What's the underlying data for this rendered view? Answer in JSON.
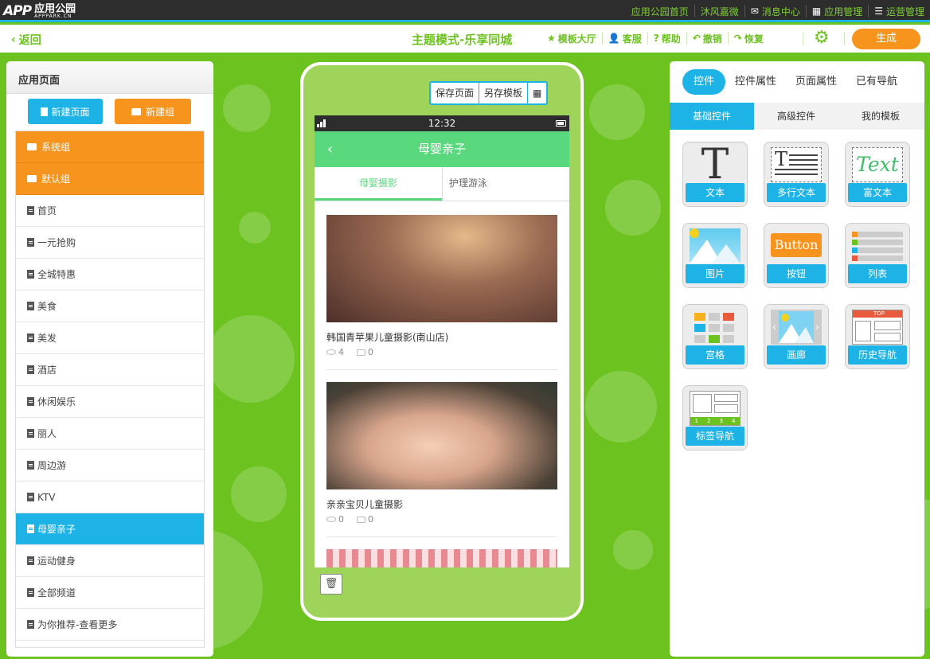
{
  "brand": {
    "mark": "APP",
    "name": "应用公园",
    "sub": "APPPARK.CN"
  },
  "toplinks": [
    {
      "label": "应用公园首页",
      "icon": ""
    },
    {
      "label": "沐风嘉微",
      "icon": ""
    },
    {
      "label": "消息中心",
      "icon": "✉"
    },
    {
      "label": "应用管理",
      "icon": "▦"
    },
    {
      "label": "运营管理",
      "icon": "☰"
    }
  ],
  "subbar": {
    "back": "返回",
    "mode_title": "主题模式-乐享同城",
    "tools": [
      {
        "label": "模板大厅",
        "icon": "★"
      },
      {
        "label": "客服",
        "icon": "👤"
      },
      {
        "label": "帮助",
        "icon": "?"
      },
      {
        "label": "撤销",
        "icon": "↶"
      },
      {
        "label": "恢复",
        "icon": "↷"
      }
    ],
    "generate": "生成"
  },
  "left": {
    "title": "应用页面",
    "new_page": "新建页面",
    "new_group": "新建组",
    "groups": [
      {
        "label": "系统组"
      },
      {
        "label": "默认组"
      }
    ],
    "pages": [
      "首页",
      "一元抢购",
      "全城特惠",
      "美食",
      "美发",
      "酒店",
      "休闲娱乐",
      "丽人",
      "周边游",
      "KTV",
      "母婴亲子",
      "运动健身",
      "全部频道",
      "为你推荐-查看更多"
    ],
    "active_index": 10
  },
  "phone": {
    "tools": [
      "保存页面",
      "另存模板",
      "▦"
    ],
    "time": "12:32",
    "nav_title": "母婴亲子",
    "tabs": [
      "母婴摄影",
      "护理游泳"
    ],
    "items": [
      {
        "title": "韩国青苹果儿童摄影(南山店)",
        "views": "4",
        "comments": "0"
      },
      {
        "title": "亲亲宝贝儿童摄影",
        "views": "0",
        "comments": "0"
      }
    ]
  },
  "right": {
    "tabs": [
      "控件",
      "控件属性",
      "页面属性",
      "已有导航"
    ],
    "subtabs": [
      "基础控件",
      "高级控件",
      "我的模板"
    ],
    "widgets": [
      "文本",
      "多行文本",
      "富文本",
      "图片",
      "按钮",
      "列表",
      "宫格",
      "画廊",
      "历史导航",
      "标签导航"
    ],
    "art": {
      "big_t": "T",
      "small_t": "T",
      "text_word": "Text",
      "button_word": "Button",
      "top_word": "TOP",
      "nums": [
        "1",
        "2",
        "3",
        "4"
      ]
    }
  }
}
